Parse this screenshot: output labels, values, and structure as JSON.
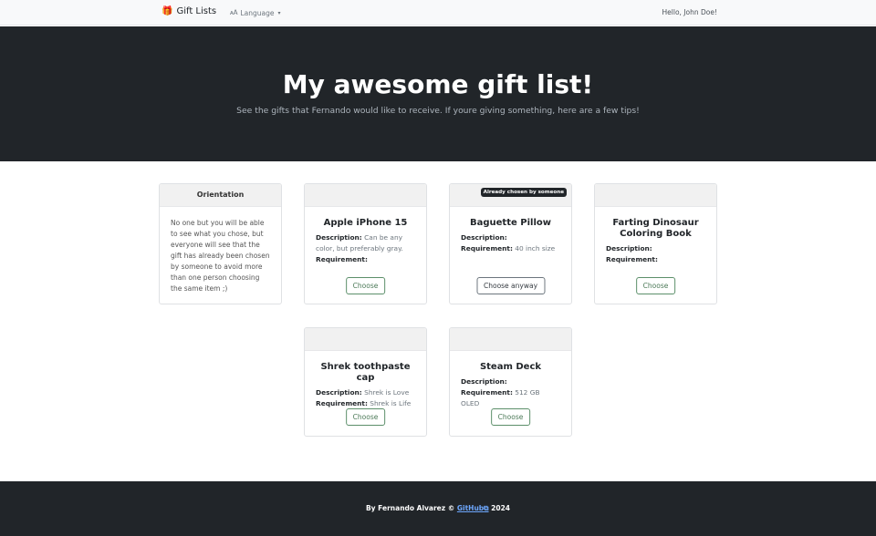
{
  "navbar": {
    "brand_icon": "gift-icon",
    "brand_label": "Gift Lists",
    "language_icon": "language-icon",
    "language_label": "Language",
    "greeting": "Hello, John Doe!"
  },
  "hero": {
    "title": "My awesome gift list!",
    "subtitle": "See the gifts that Fernando would like to receive. If youre giving something, here are a few tips!"
  },
  "orientation": {
    "header": "Orientation",
    "text": "No one but you will be able to see what you chose, but everyone will see that the gift has already been chosen by someone to avoid more than one person choosing the same item ;)"
  },
  "gifts": [
    {
      "title": "Apple iPhone 15",
      "description_label": "Description:",
      "description": "Can be any color, but preferably gray.",
      "requirement_label": "Requirement:",
      "requirement": "",
      "button": "Choose",
      "badge": ""
    },
    {
      "title": "Baguette Pillow",
      "description_label": "Description:",
      "description": "",
      "requirement_label": "Requirement:",
      "requirement": "40 inch size",
      "button": "Choose anyway",
      "badge": "Already chosen by someone"
    },
    {
      "title": "Farting Dinosaur Coloring Book",
      "description_label": "Description:",
      "description": "",
      "requirement_label": "Requirement:",
      "requirement": "",
      "button": "Choose",
      "badge": ""
    },
    {
      "title": "Shrek toothpaste cap",
      "description_label": "Description:",
      "description": "Shrek is Love",
      "requirement_label": "Requirement:",
      "requirement": "Shrek is Life",
      "button": "Choose",
      "badge": ""
    },
    {
      "title": "Steam Deck",
      "description_label": "Description:",
      "description": "",
      "requirement_label": "Requirement:",
      "requirement": "512 GB OLED",
      "button": "Choose",
      "badge": ""
    }
  ],
  "footer": {
    "prefix": "By Fernando Alvarez ©",
    "link_label": "GitHub",
    "link_icon": "external-link-icon",
    "year": "2024"
  },
  "colors": {
    "dark": "#212529",
    "button_outline": "#5c8f6a",
    "link": "#6ea8fe"
  }
}
